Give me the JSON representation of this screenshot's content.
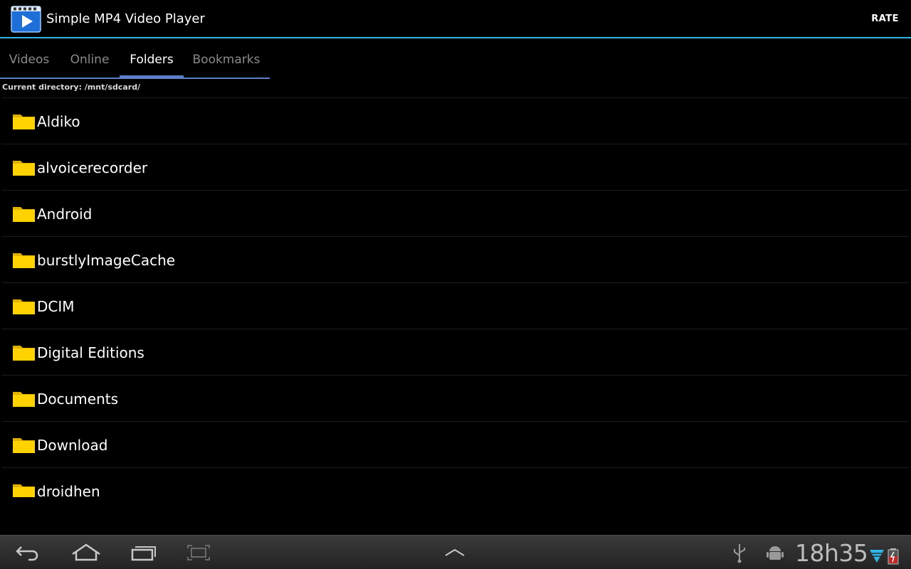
{
  "app": {
    "title": "Simple MP4 Video Player",
    "icon": "video-play-icon",
    "rate_label": "RATE"
  },
  "tabs": [
    {
      "label": "Videos",
      "active": false
    },
    {
      "label": "Online",
      "active": false
    },
    {
      "label": "Folders",
      "active": true
    },
    {
      "label": "Bookmarks",
      "active": false
    }
  ],
  "current_directory": "Current directory: /mnt/sdcard/",
  "folders": [
    "Aldiko",
    "alvoicerecorder",
    "Android",
    "burstlyImageCache",
    "DCIM",
    "Digital Editions",
    "Documents",
    "Download",
    "droidhen"
  ],
  "system_bar": {
    "clock": "18h35",
    "icons": [
      "back-icon",
      "home-icon",
      "recents-icon",
      "screenshot-icon",
      "menu-up-icon",
      "usb-icon",
      "android-debug-icon",
      "wifi-icon",
      "battery-icon"
    ]
  },
  "colors": {
    "accent_blue": "#33b5e5",
    "tab_indicator": "#5e80c9",
    "folder_yellow": "#ffd200"
  }
}
